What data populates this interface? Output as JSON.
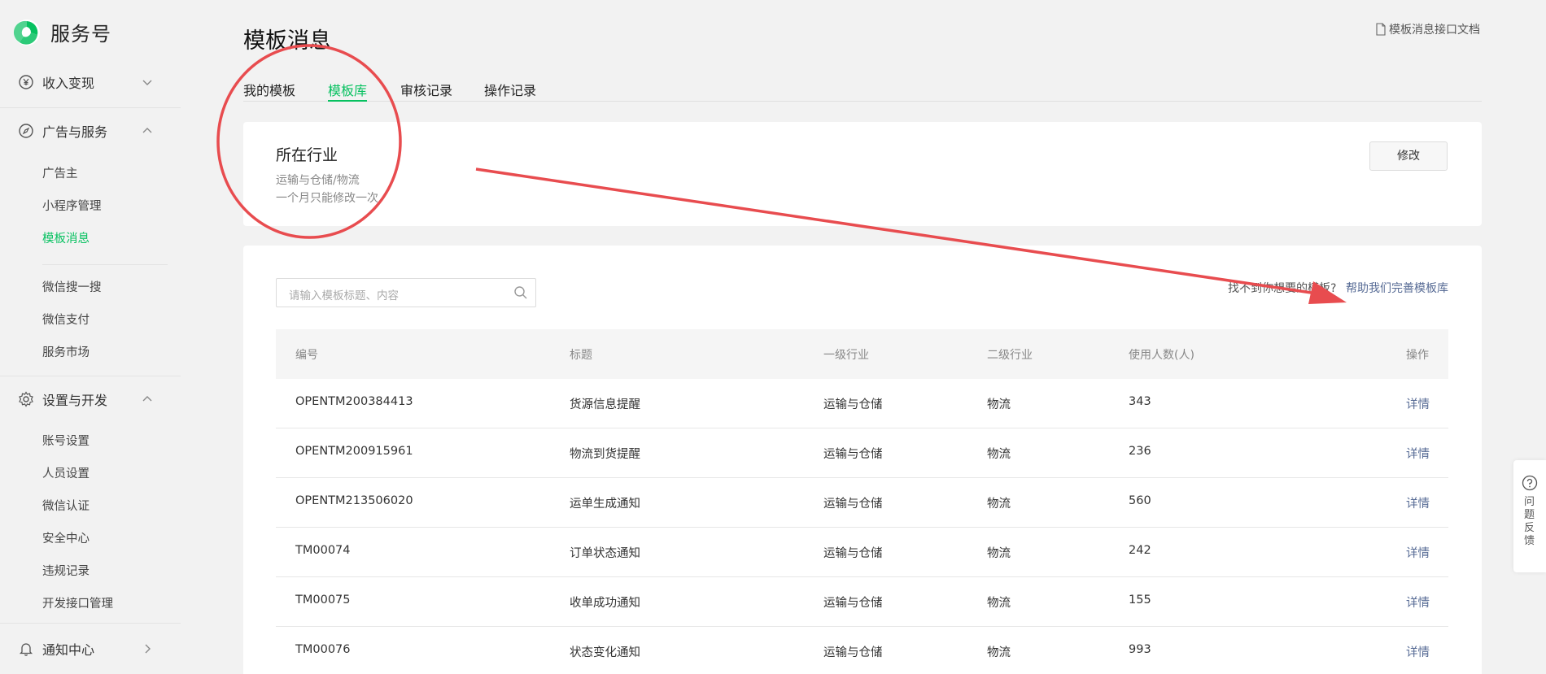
{
  "app": {
    "brand_name": "服务号",
    "brand_color": "#07c160"
  },
  "sidebar": {
    "groups": [
      {
        "label": "收入变现",
        "icon": "yen-circle-icon",
        "expanded": false
      },
      {
        "label": "广告与服务",
        "icon": "compass-icon",
        "expanded": true,
        "items": [
          "广告主",
          "小程序管理",
          "模板消息"
        ]
      },
      {
        "items": [
          "微信搜一搜",
          "微信支付",
          "服务市场"
        ]
      },
      {
        "label": "设置与开发",
        "icon": "gear-icon",
        "expanded": true,
        "items": [
          "账号设置",
          "人员设置",
          "微信认证",
          "安全中心",
          "违规记录",
          "开发接口管理"
        ]
      },
      {
        "label": "通知中心",
        "icon": "bell-icon",
        "expanded": false
      }
    ],
    "active_item": "模板消息"
  },
  "main": {
    "title": "模板消息",
    "doc_link": "模板消息接口文档",
    "tabs": [
      {
        "label": "我的模板",
        "active": false
      },
      {
        "label": "模板库",
        "active": true
      },
      {
        "label": "审核记录",
        "active": false
      },
      {
        "label": "操作记录",
        "active": false
      }
    ],
    "industry": {
      "title": "所在行业",
      "value": "运输与仓储/物流",
      "note": "一个月只能修改一次",
      "modify_label": "修改"
    },
    "library": {
      "search_placeholder": "请输入模板标题、内容",
      "help_question": "找不到你想要的模板?",
      "help_link": "帮助我们完善模板库",
      "columns": [
        "编号",
        "标题",
        "一级行业",
        "二级行业",
        "使用人数(人)",
        "操作"
      ],
      "rows": [
        {
          "id": "OPENTM200384413",
          "title": "货源信息提醒",
          "industry1": "运输与仓储",
          "industry2": "物流",
          "users": "343",
          "action": "详情"
        },
        {
          "id": "OPENTM200915961",
          "title": "物流到货提醒",
          "industry1": "运输与仓储",
          "industry2": "物流",
          "users": "236",
          "action": "详情"
        },
        {
          "id": "OPENTM213506020",
          "title": "运单生成通知",
          "industry1": "运输与仓储",
          "industry2": "物流",
          "users": "560",
          "action": "详情"
        },
        {
          "id": "TM00074",
          "title": "订单状态通知",
          "industry1": "运输与仓储",
          "industry2": "物流",
          "users": "242",
          "action": "详情"
        },
        {
          "id": "TM00075",
          "title": "收单成功通知",
          "industry1": "运输与仓储",
          "industry2": "物流",
          "users": "155",
          "action": "详情"
        },
        {
          "id": "TM00076",
          "title": "状态变化通知",
          "industry1": "运输与仓储",
          "industry2": "物流",
          "users": "993",
          "action": "详情"
        }
      ]
    }
  },
  "feedback": {
    "label": "问题反馈"
  },
  "annotation": {
    "color": "#e84c4f",
    "shapes": [
      "circle",
      "arrow"
    ]
  }
}
